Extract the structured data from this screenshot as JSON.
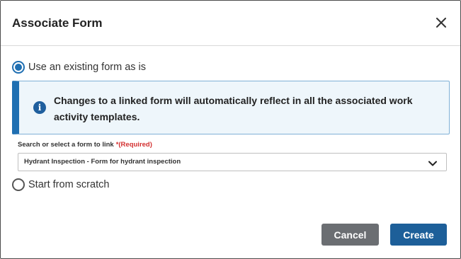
{
  "dialog": {
    "title": "Associate Form",
    "close_icon": "close-icon"
  },
  "options": {
    "existing_label": "Use an existing form as is",
    "existing_selected": true,
    "scratch_label": "Start from scratch",
    "scratch_selected": false
  },
  "banner": {
    "icon": "info-icon",
    "icon_glyph": "i",
    "text": "Changes to a linked form will automatically reflect in all the associated work activity templates."
  },
  "form_select": {
    "label": "Search or select a form to link",
    "required_text": "*(Required)",
    "value": "Hydrant Inspection - Form for hydrant inspection",
    "icon": "chevron-down-icon"
  },
  "buttons": {
    "cancel_label": "Cancel",
    "create_label": "Create"
  },
  "colors": {
    "accent": "#1f6fb2",
    "banner_bg": "#eef6fb",
    "required": "#d32f2f",
    "cancel_bg": "#6b6e72",
    "create_bg": "#1d5f99"
  }
}
